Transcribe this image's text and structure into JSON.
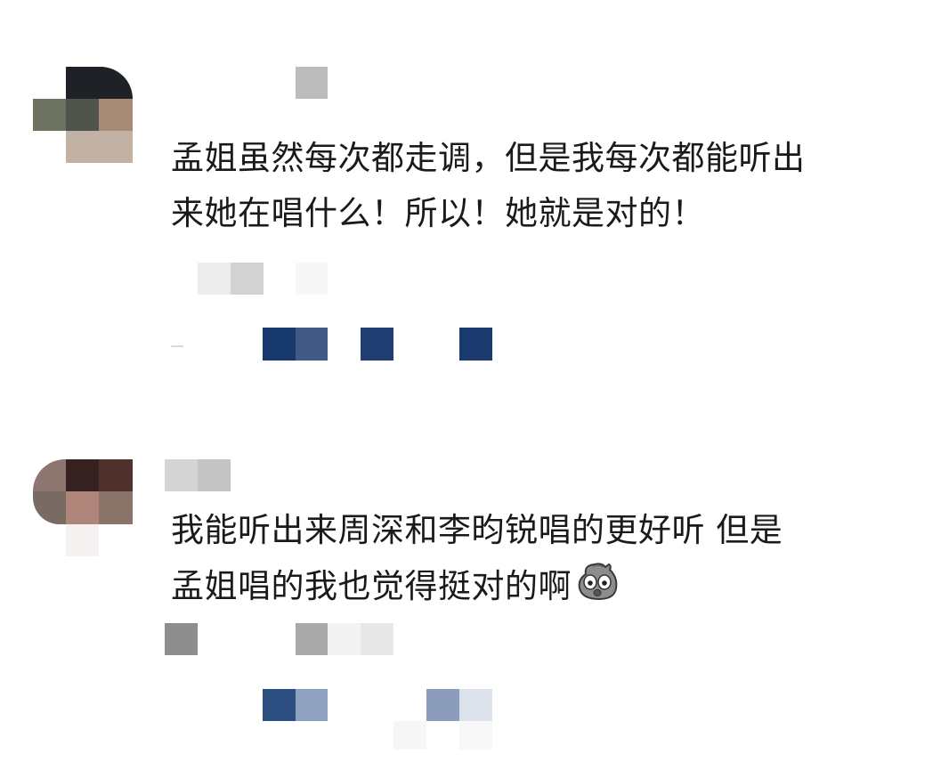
{
  "comments": [
    {
      "text_lines": [
        "孟姐虽然每次都走调，但是我每次都能听出",
        "来她在唱什么！所以！她就是对的！"
      ],
      "mosaic_colors": {
        "avatar": [
          "#1e2226",
          "#6e7361",
          "#4f544c",
          "#a68a75",
          "#c2b2a3"
        ],
        "username": "#bcbcbc",
        "meta": [
          "#ededed",
          "#d2d2d2",
          "#f7f7f7"
        ],
        "actions": [
          "#18396d",
          "#405a85",
          "#1f3f73",
          "#1b3b6e"
        ]
      }
    },
    {
      "text_lines": [
        "我能听出来周深和李昀锐唱的更好听 但是",
        "孟姐唱的我也觉得挺对的啊"
      ],
      "emoji_icon": "shocked-face-emoji",
      "mosaic_colors": {
        "avatar": [
          "#8d7670",
          "#35211f",
          "#4e312c",
          "#7a6a64",
          "#b1867a",
          "#8a7368",
          "#f4f1f0"
        ],
        "username": [
          "#d4d4d4",
          "#c4c4c4"
        ],
        "meta": [
          "#8e8e8e",
          "#a9a9a9",
          "#f3f3f3",
          "#e8e8e8"
        ],
        "actions": [
          "#2d4e80",
          "#8ea1bf",
          "#8b9dbb",
          "#dce1ea"
        ]
      }
    }
  ]
}
